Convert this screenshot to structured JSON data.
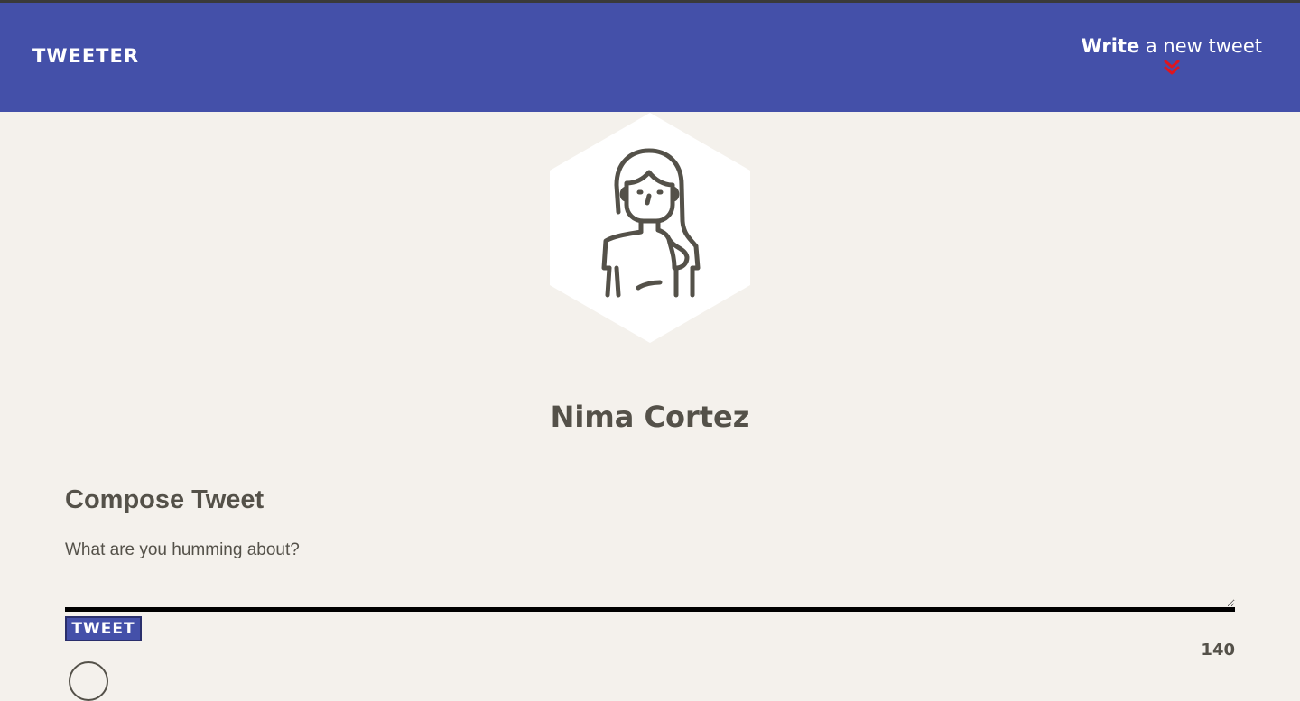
{
  "nav": {
    "brand": "TWEETER",
    "write_bold": "Write",
    "write_rest": " a new tweet",
    "chevron_icon": "double-chevron-down-icon",
    "chevron_color": "#e0151e",
    "bg_color": "#4450a9"
  },
  "profile": {
    "avatar_icon": "woman-avatar-icon",
    "name": "Nima Cortez"
  },
  "compose": {
    "title": "Compose Tweet",
    "placeholder": "What are you humming about?",
    "value": "",
    "button_label": "TWEET",
    "counter": "140"
  }
}
